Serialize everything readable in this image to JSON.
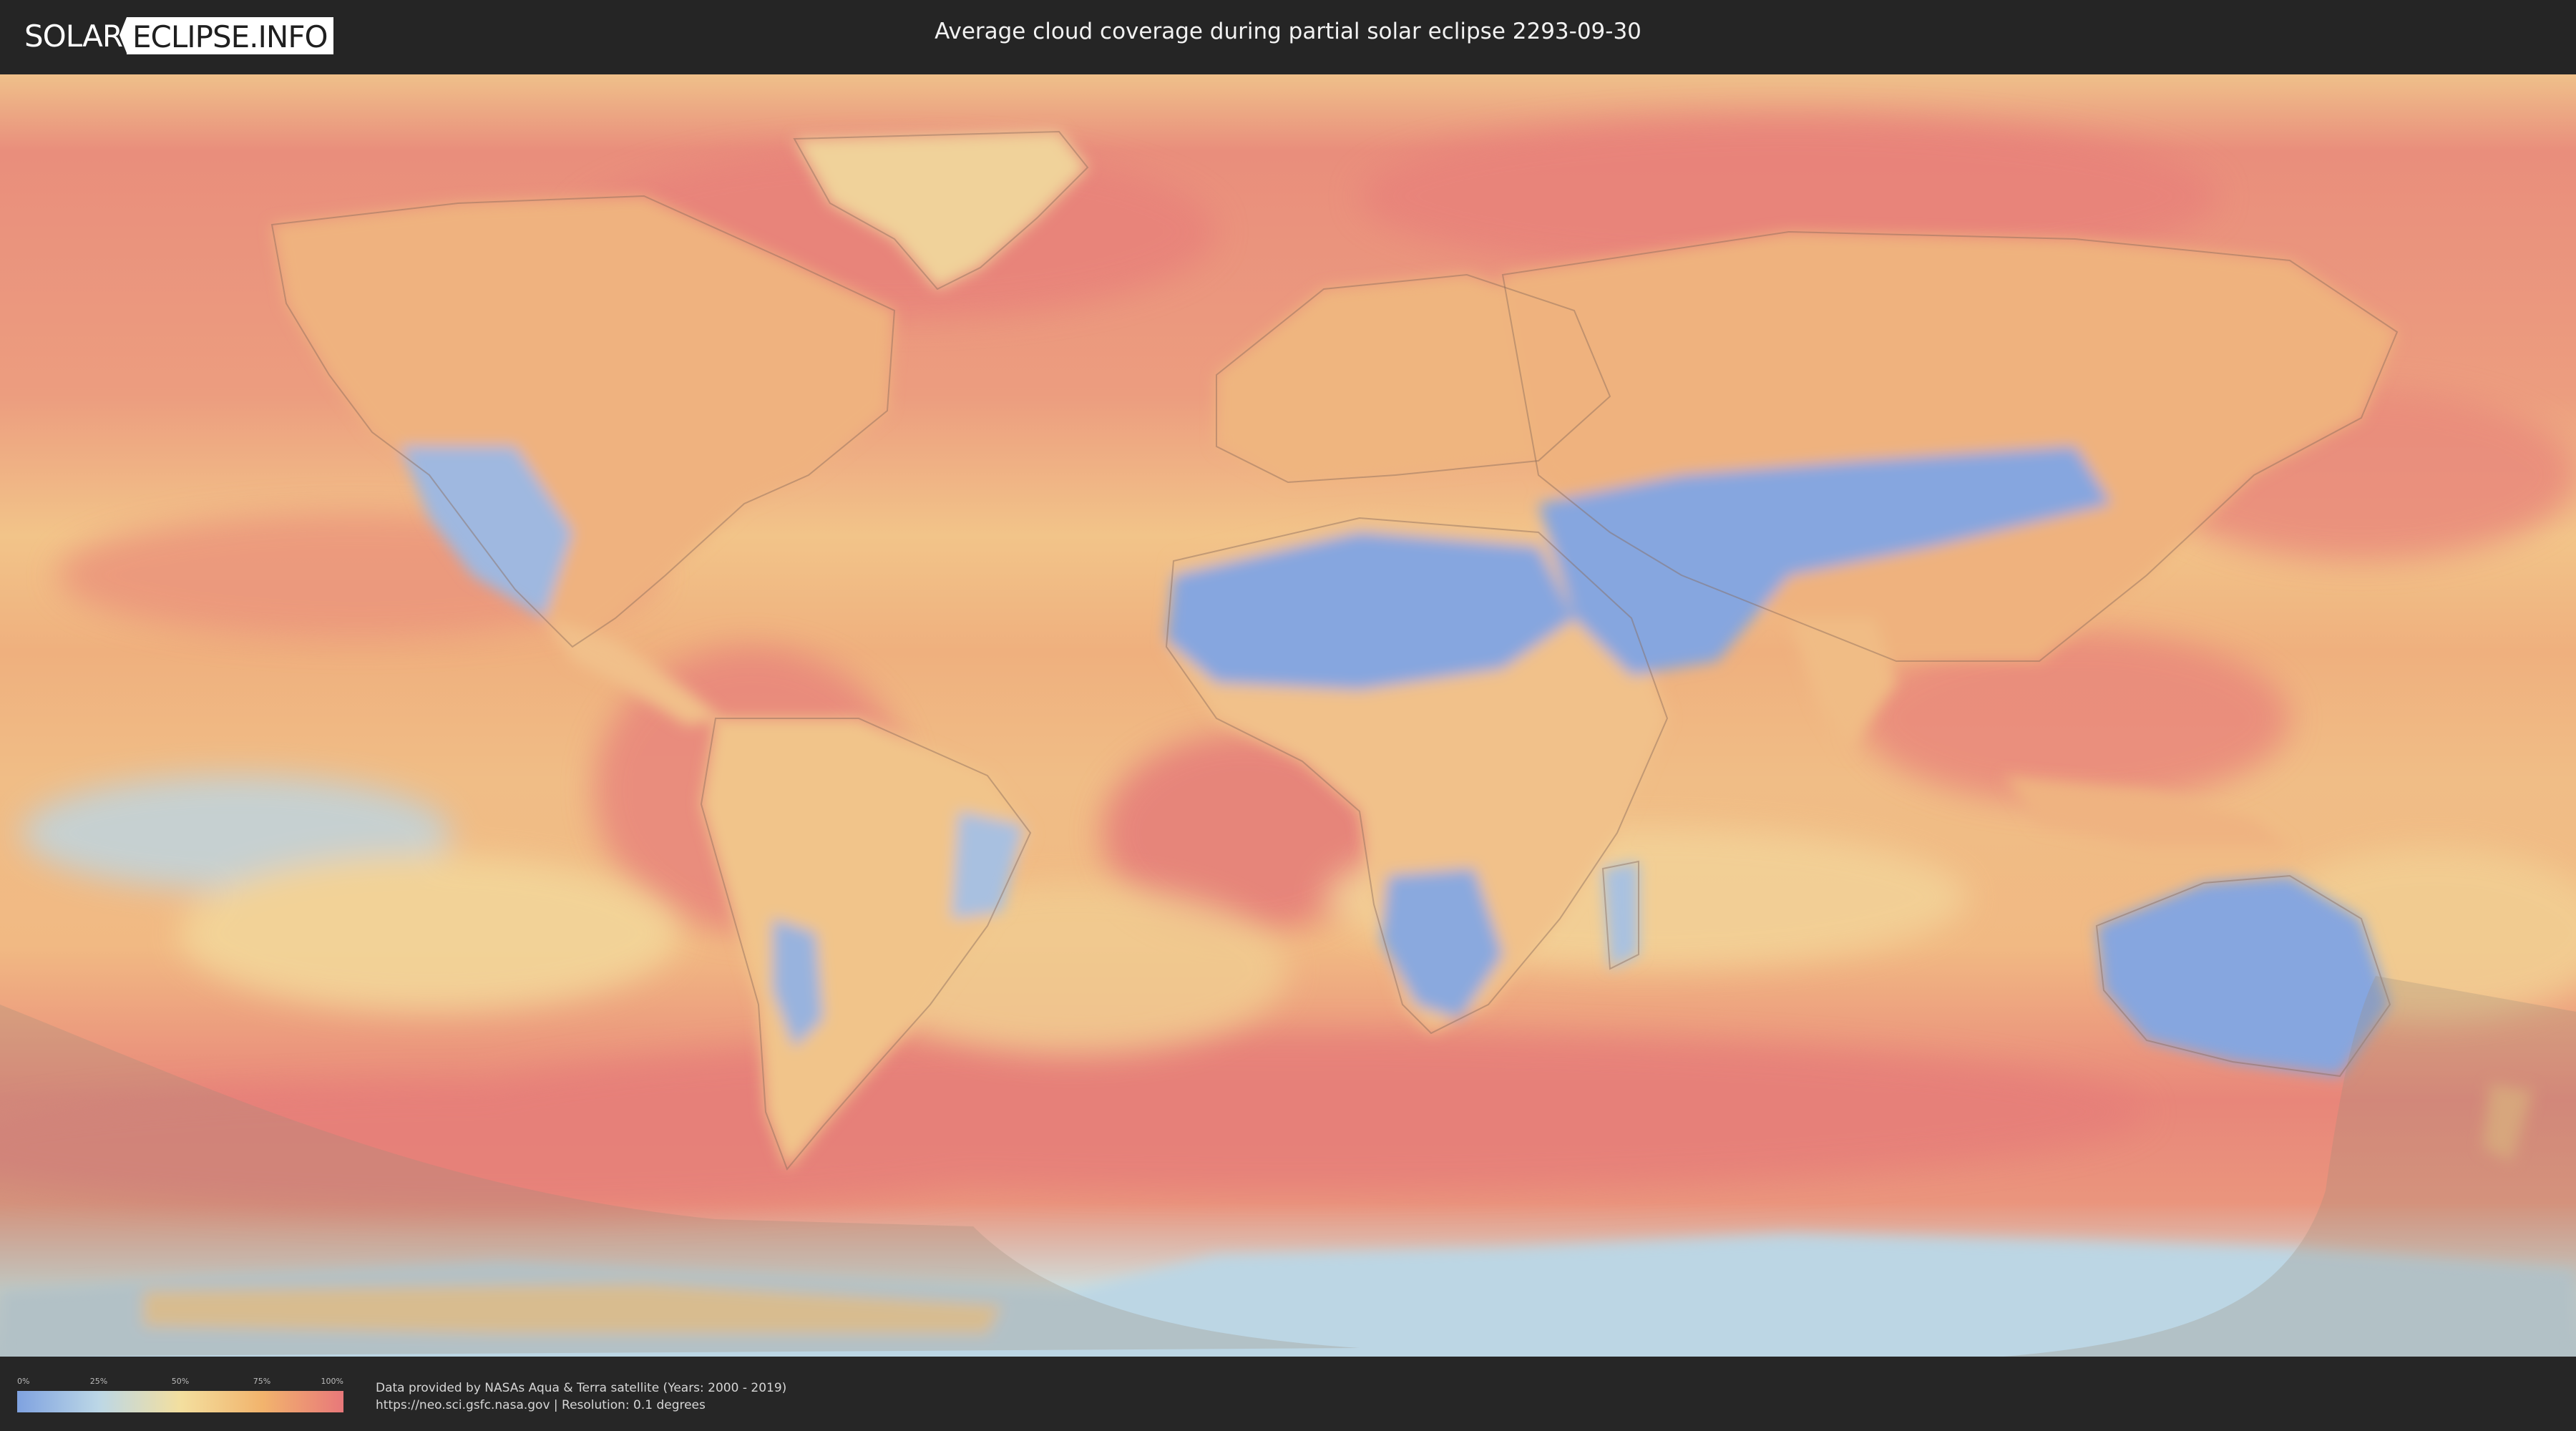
{
  "header": {
    "logo_left": "SOLAR",
    "logo_right": "ECLIPSE.INFO",
    "title": "Average cloud coverage during partial solar eclipse 2293-09-30"
  },
  "legend": {
    "ticks": [
      "0%",
      "25%",
      "50%",
      "75%",
      "100%"
    ],
    "colors": [
      "#7fa2e0",
      "#bcd7e6",
      "#f3df9f",
      "#f2b46d",
      "#e8787a"
    ]
  },
  "credits": {
    "line1": "Data provided by NASAs Aqua & Terra satellite (Years: 2000 - 2019)",
    "line2": "https://neo.sci.gsfc.nasa.gov | Resolution: 0.1 degrees"
  },
  "map": {
    "colors": {
      "ocean_cloudy": "#e9907d",
      "mid": "#efb882",
      "land_clear": "#88a8df",
      "ice": "#bcd6e4",
      "shadow": "#c9b08a"
    }
  }
}
